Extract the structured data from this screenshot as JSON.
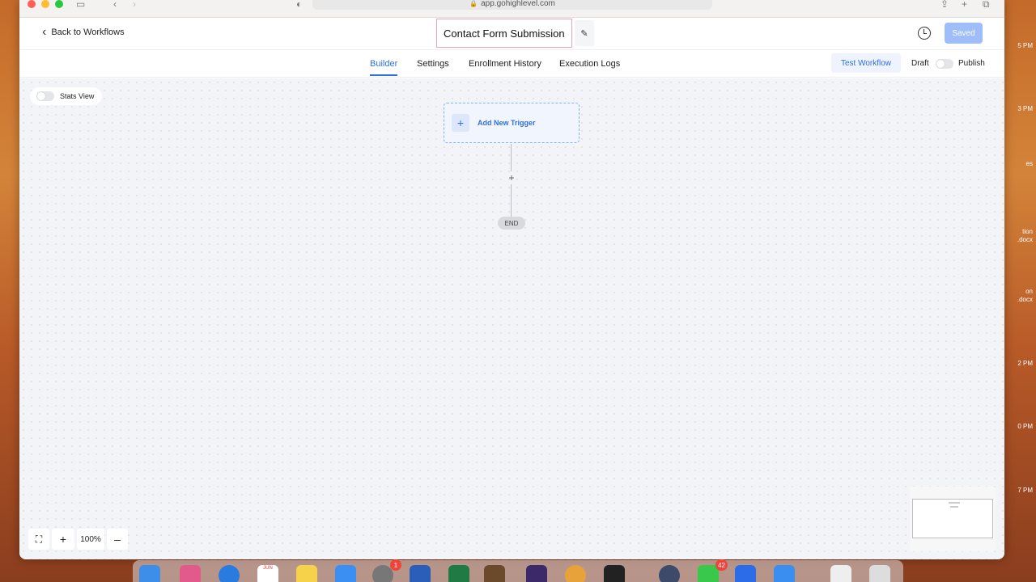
{
  "browser": {
    "url": "app.gohighlevel.com"
  },
  "header": {
    "back_label": "Back to Workflows",
    "workflow_title": "Contact Form Submission",
    "saved_label": "Saved"
  },
  "tabs": [
    {
      "label": "Builder",
      "active": true
    },
    {
      "label": "Settings",
      "active": false
    },
    {
      "label": "Enrollment History",
      "active": false
    },
    {
      "label": "Execution Logs",
      "active": false
    }
  ],
  "actions": {
    "test_workflow_label": "Test Workflow",
    "draft_label": "Draft",
    "publish_label": "Publish"
  },
  "canvas": {
    "stats_view_label": "Stats View",
    "add_trigger_label": "Add New Trigger",
    "add_step_symbol": "+",
    "end_label": "END"
  },
  "zoom": {
    "fit_icon": "fit-view-icon",
    "zoom_in_symbol": "+",
    "zoom_level": "100%",
    "zoom_out_symbol": "–"
  },
  "dock": {
    "calendar_month": "JUN",
    "calendar_day": "17",
    "badges": [
      "1",
      "42"
    ]
  },
  "desktop_labels": [
    "5 PM",
    "3 PM",
    "es",
    "tion .docx",
    "on .docx",
    "2 PM",
    "0 PM",
    "7 PM"
  ],
  "colors": {
    "accent": "#2f6fe0",
    "saved_button": "#9fbdf8",
    "title_highlight": "#f0a0b8",
    "canvas_bg": "#f3f4f7"
  }
}
